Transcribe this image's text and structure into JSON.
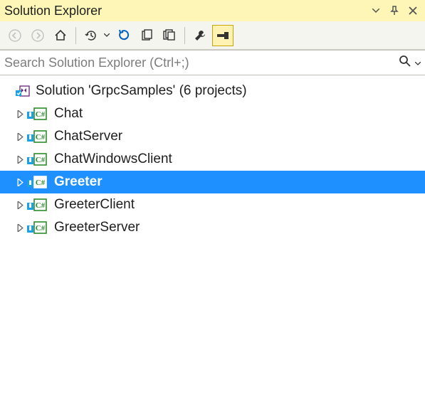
{
  "title": "Solution Explorer",
  "search": {
    "placeholder": "Search Solution Explorer (Ctrl+;)"
  },
  "solution": {
    "label": "Solution 'GrpcSamples' (6 projects)"
  },
  "projects": [
    {
      "name": "Chat",
      "selected": false
    },
    {
      "name": "ChatServer",
      "selected": false
    },
    {
      "name": "ChatWindowsClient",
      "selected": false
    },
    {
      "name": "Greeter",
      "selected": true
    },
    {
      "name": "GreeterClient",
      "selected": false
    },
    {
      "name": "GreeterServer",
      "selected": false
    }
  ]
}
